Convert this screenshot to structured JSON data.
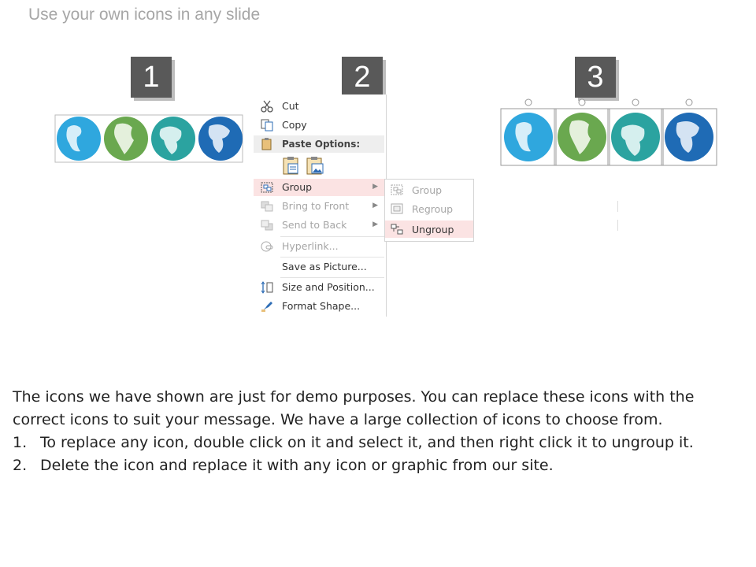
{
  "slide": {
    "title": "Use your own icons in any slide"
  },
  "steps": [
    "1",
    "2",
    "3"
  ],
  "context_menu": {
    "items": [
      {
        "label": "Cut",
        "icon": "scissors-icon"
      },
      {
        "label": "Copy",
        "icon": "copy-icon"
      },
      {
        "label": "Paste Options:",
        "icon": "clipboard-icon"
      },
      {
        "label": "Group",
        "icon": "group-icon"
      },
      {
        "label": "Bring to Front",
        "icon": "bring-to-front-icon"
      },
      {
        "label": "Send to Back",
        "icon": "send-to-back-icon"
      },
      {
        "label": "Hyperlink...",
        "icon": "hyperlink-icon"
      },
      {
        "label": "Save as Picture...",
        "icon": ""
      },
      {
        "label": "Size and Position...",
        "icon": "size-position-icon"
      },
      {
        "label": "Format Shape...",
        "icon": "format-shape-icon"
      }
    ],
    "submenu": [
      {
        "label": "Group",
        "icon": "group-icon"
      },
      {
        "label": "Regroup",
        "icon": "regroup-icon"
      },
      {
        "label": "Ungroup",
        "icon": "ungroup-icon"
      }
    ]
  },
  "globe_colors": [
    "#2fa7de",
    "#6aa84f",
    "#2ba3a0",
    "#1f6bb5"
  ],
  "body": {
    "intro": "The icons we have shown are just for demo purposes. You can replace these icons with the correct icons to suit your message. We have a large collection of icons to choose from.",
    "steps": [
      {
        "num": "1.",
        "text": "To replace any icon, double click on it and select it, and then right click it to ungroup it."
      },
      {
        "num": "2.",
        "text": "Delete the icon and replace it with any icon or graphic from our site."
      }
    ]
  }
}
